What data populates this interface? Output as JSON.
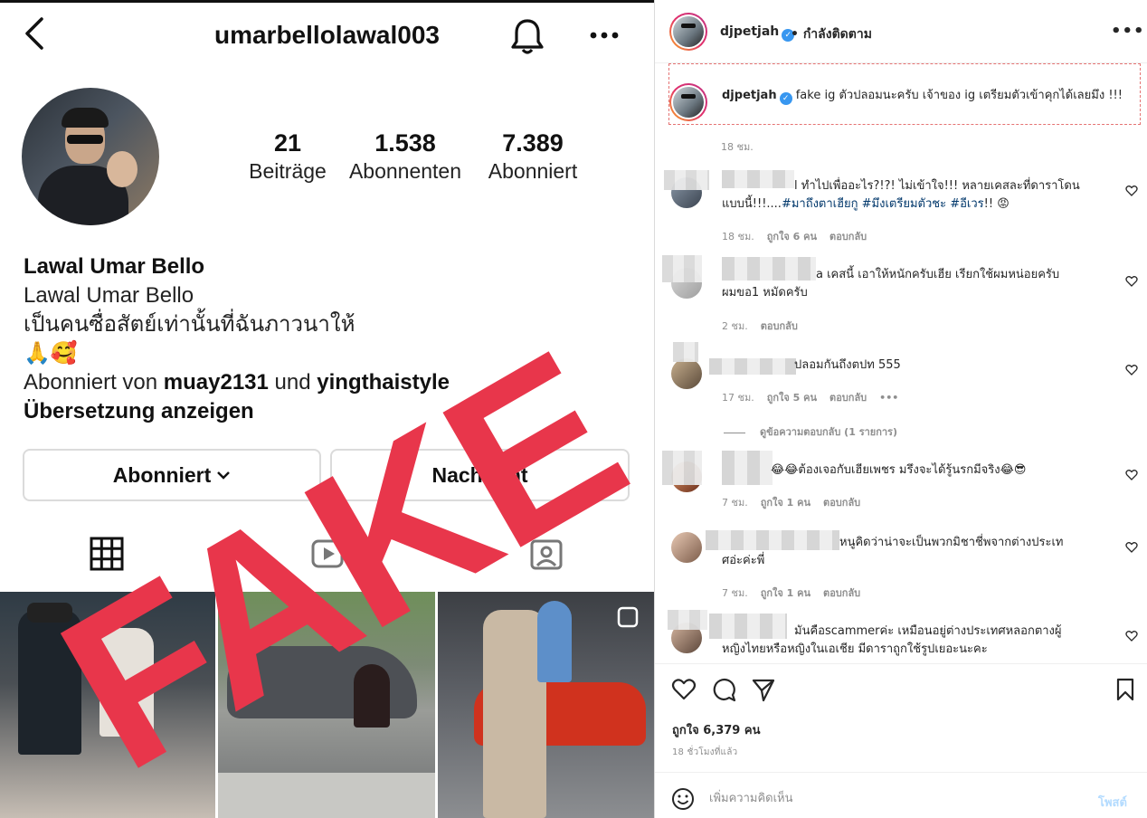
{
  "profile": {
    "username": "umarbellolawal003",
    "stats": [
      {
        "num": "21",
        "label": "Beiträge"
      },
      {
        "num": "1.538",
        "label": "Abonnenten"
      },
      {
        "num": "7.389",
        "label": "Abonniert"
      }
    ],
    "display_name": "Lawal Umar Bello",
    "bio_name": "Lawal Umar Bello",
    "bio_line": "เป็นคนซื่อสัตย์เท่านั้นที่ฉันภาวนาให้",
    "bio_emoji": "🙏🥰",
    "followed_by_prefix": "Abonniert von ",
    "followed_by_user1": "muay2131",
    "followed_by_and": " und ",
    "followed_by_user2": "yingthaistyle",
    "translate": "Übersetzung anzeigen",
    "follow_button": "Abonniert",
    "message_button": "Nachricht",
    "stamp": "FAKE"
  },
  "post": {
    "author": "djpetjah",
    "dot": "•",
    "following_label": "กำลังติดตาม",
    "caption_author": "djpetjah",
    "caption_text": "fake ig ตัวปลอมนะครับ เจ้าของ ig เตรียมตัวเข้าคุกได้เลยมึง !!!",
    "caption_time": "18 ชม.",
    "likes": "ถูกใจ 6,379 คน",
    "time_ago": "18 ชั่วโมงที่แล้ว",
    "add_comment_placeholder": "เพิ่มความคิดเห็น",
    "post_button": "โพสต์"
  },
  "comments": [
    {
      "text_a": "l ทำไปเพื่ออะไร?!?! ไม่เข้าใจ!!! หลายเคสละที่ดาราโดน",
      "text_b": "แบบนี้!!!....",
      "tags": "#มาถึงตาเฮียกู #มึงเตรียมตัวชะ #อีเวร",
      "tail": "!! 😡",
      "time": "18 ชม.",
      "likes": "ถูกใจ 6 คน",
      "reply": "ตอบกลับ"
    },
    {
      "text_a": "a เคสนี้ เอาให้หนักครับเฮีย เรียกใช้ผมหน่อยครับ",
      "text_b": "ผมขอ1 หมัดครับ",
      "time": "2 ชม.",
      "reply": "ตอบกลับ"
    },
    {
      "text_a": "ปลอมกันถึงตปท 555",
      "time": "17 ชม.",
      "likes": "ถูกใจ 5 คน",
      "reply": "ตอบกลับ",
      "more": "•••",
      "view_replies": "ดูข้อความตอบกลับ (1 รายการ)"
    },
    {
      "text_a": "😂😂ต้องเจอกับเฮียเพชร มรึงจะได้รู้นรกมีจริง😂😎",
      "time": "7 ชม.",
      "likes": "ถูกใจ 1 คน",
      "reply": "ตอบกลับ"
    },
    {
      "text_a": "หนูคิดว่าน่าจะเป็นพวกมิชาชี่พจากต่างประเท",
      "text_b": "ศอ่ะค่ะพี่",
      "time": "7 ชม.",
      "likes": "ถูกใจ 1 คน",
      "reply": "ตอบกลับ"
    },
    {
      "text_a": "มันคือscammerค่ะ เหมือนอยู่ต่างประเทศหลอกตางผู้",
      "text_b": "หญิงไทยหรือหญิงในเอเชีย มีดาราถูกใช้รูปเยอะนะคะ"
    }
  ]
}
